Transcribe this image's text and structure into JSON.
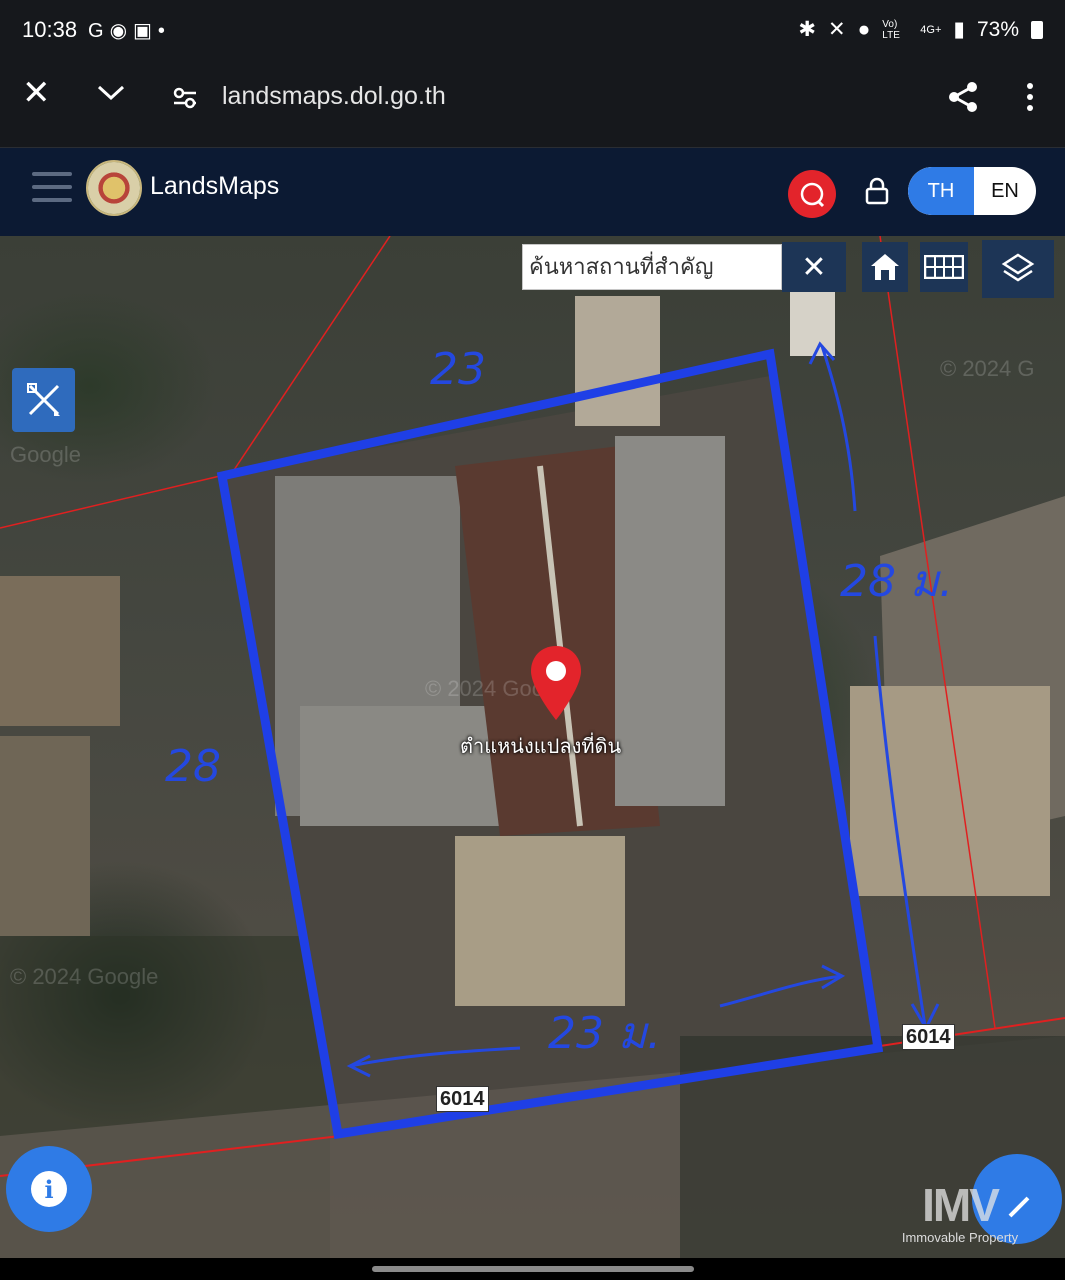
{
  "status_bar": {
    "time": "10:38",
    "left_icons": [
      "google-icon",
      "line-icon",
      "gallery-icon",
      "dot-icon"
    ],
    "right_icons": [
      "bluetooth-icon",
      "mute-icon",
      "location-icon",
      "volte-icon",
      "4g-icon",
      "signal-icon"
    ],
    "volte_text": "Vo) LTE",
    "network_text": "4G+",
    "battery": "73%"
  },
  "browser": {
    "url": "landsmaps.dol.go.th",
    "icons": [
      "close-icon",
      "chevron-down-icon",
      "site-settings-icon",
      "share-icon",
      "more-icon"
    ]
  },
  "app_header": {
    "title": "LandsMaps",
    "lang_th": "TH",
    "lang_en": "EN",
    "active_lang": "TH",
    "accent_color": "#2f7be6",
    "search_color": "#e3242b"
  },
  "map": {
    "search_placeholder": "ค้นหาสถานที่สำคัญ",
    "clear_symbol": "✕",
    "parcel_label": "ตำแหน่งแปลงที่ดิน",
    "road_labels": [
      "6014",
      "6014"
    ],
    "copyright": [
      "© 2024 Google",
      "© 2024 Google",
      "Google",
      "© 2024 G",
      "© 2024 Google"
    ],
    "handwritten": {
      "top_side": "23",
      "right_side": "28 ม.",
      "left_side": "28",
      "bottom_side": "23 ม."
    },
    "parcel_color": "#1f3fe6",
    "boundary_color": "#e02020"
  },
  "watermark": {
    "mark": "IMV",
    "text": "Immovable Property"
  }
}
